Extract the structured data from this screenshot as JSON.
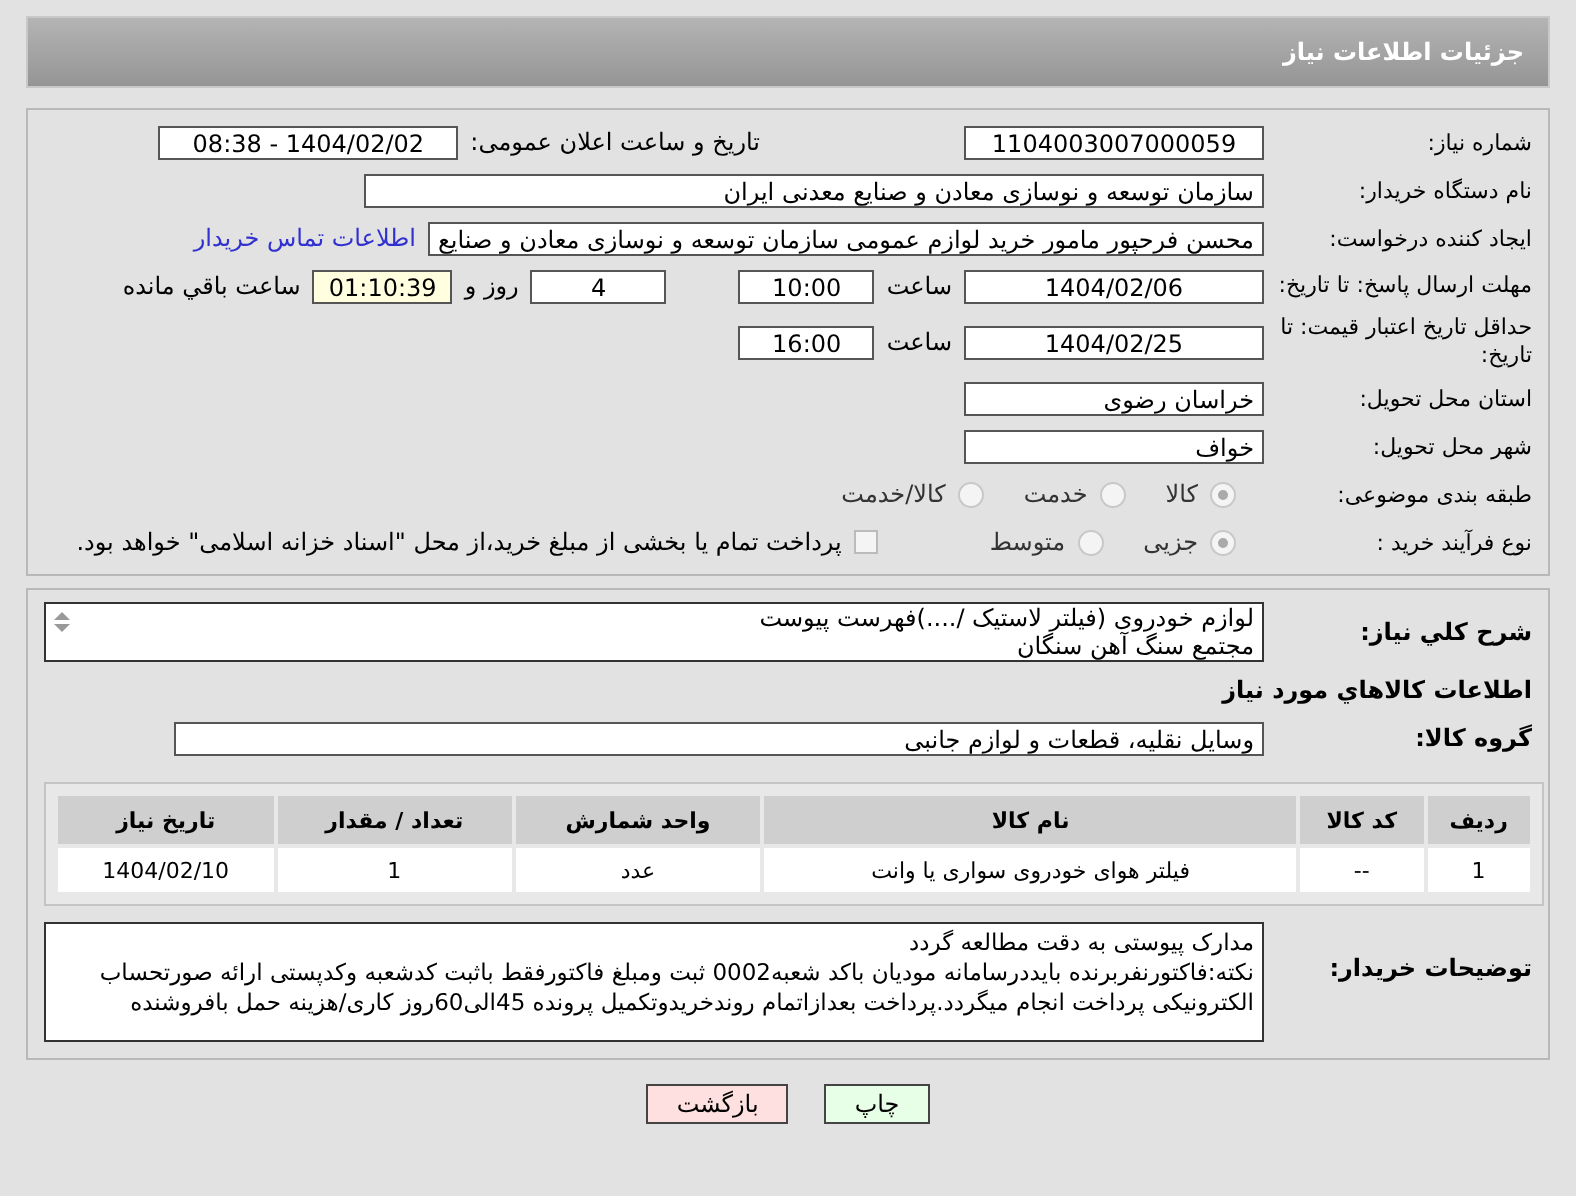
{
  "header": {
    "title": "جزئیات اطلاعات نیاز"
  },
  "need_number": {
    "label": "شماره نیاز:",
    "value": "1104003007000059"
  },
  "announce": {
    "label": "تاریخ و ساعت اعلان عمومی:",
    "value": "1404/02/02 - 08:38"
  },
  "buyer_org": {
    "label": "نام دستگاه خریدار:",
    "value": "سازمان توسعه و نوسازی معادن و صنایع معدنی ایران"
  },
  "requester": {
    "label": "ایجاد کننده درخواست:",
    "value": "محسن فرحپور مامور خرید لوازم عمومی سازمان توسعه و نوسازی معادن و صنایع",
    "link": "اطلاعات تماس خریدار"
  },
  "reply_deadline": {
    "label": "مهلت ارسال پاسخ: تا تاریخ:",
    "date": "1404/02/06",
    "time_label": "ساعت",
    "time": "10:00",
    "days": "4",
    "days_label": "روز و",
    "remaining": "01:10:39",
    "remaining_label": "ساعت باقي مانده"
  },
  "price_validity": {
    "label": "حداقل تاریخ اعتبار قیمت: تا تاریخ:",
    "date": "1404/02/25",
    "time_label": "ساعت",
    "time": "16:00"
  },
  "province": {
    "label": "استان محل تحویل:",
    "value": "خراسان رضوی"
  },
  "city": {
    "label": "شهر محل تحویل:",
    "value": "خواف"
  },
  "category": {
    "label": "طبقه بندی موضوعی:",
    "options": [
      {
        "label": "كالا",
        "selected": true
      },
      {
        "label": "خدمت",
        "selected": false
      },
      {
        "label": "كالا/خدمت",
        "selected": false
      }
    ]
  },
  "process": {
    "label": "نوع فرآیند خرید :",
    "options": [
      {
        "label": "جزیی",
        "selected": true
      },
      {
        "label": "متوسط",
        "selected": false
      }
    ],
    "treasury": {
      "label": "پرداخت تمام یا بخشی از مبلغ خرید،از محل \"اسناد خزانه اسلامی\" خواهد بود.",
      "checked": false
    }
  },
  "description": {
    "label": "شرح کلي نياز:",
    "value": "لوازم خودروی (فیلتر لاستیک /....)فهرست پیوست\nمجتمع سنگ آهن سنگان"
  },
  "goods_title": "اطلاعات کالاهاي مورد نياز",
  "goods_group": {
    "label": "گروه کالا:",
    "value": "وسایل نقلیه، قطعات و لوازم جانبی"
  },
  "table": {
    "columns": [
      "ردیف",
      "کد کالا",
      "نام کالا",
      "واحد شمارش",
      "تعداد / مقدار",
      "تاریخ نیاز"
    ],
    "rows": [
      [
        "1",
        "--",
        "فیلتر هوای خودروی سواری یا وانت",
        "عدد",
        "1",
        "1404/02/10"
      ]
    ]
  },
  "buyer_notes": {
    "label": "توضیحات خریدار:",
    "value": "مدارک پیوستی به دقت مطالعه گردد\nنکته:فاکتورنفربرنده بایددرسامانه مودیان باکد شعبه0002 ثبت ومبلغ فاکتورفقط باثبت کدشعبه وکدپستی ارائه صورتحساب الکترونیکی پرداخت انجام میگردد.پرداخت بعدازاتمام روندخریدوتکمیل پرونده 45الی60روز کاری/هزینه حمل بافروشنده"
  },
  "buttons": [
    {
      "label": "چاپ",
      "kind": "print"
    },
    {
      "label": "بازگشت",
      "kind": "back"
    }
  ]
}
